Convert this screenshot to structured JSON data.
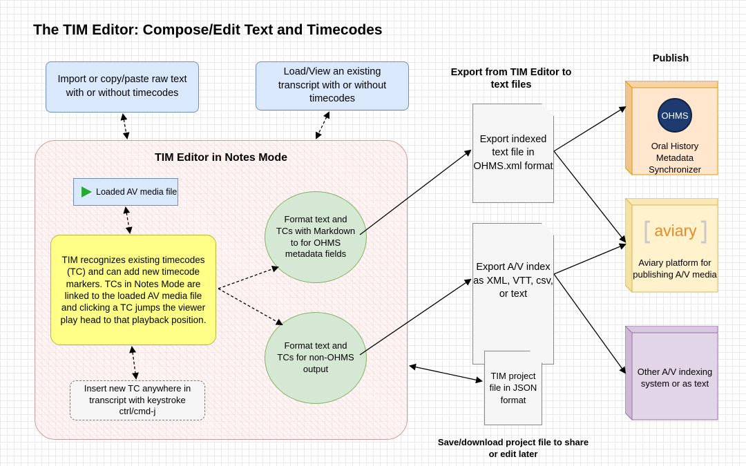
{
  "title": "The TIM Editor: Compose/Edit Text and Timecodes",
  "inputs": {
    "import": "Import or copy/paste raw text with or without timecodes",
    "load": "Load/View an existing transcript with or without timecodes"
  },
  "notes_mode": {
    "title": "TIM Editor in Notes Mode",
    "media_label": "Loaded AV media file",
    "recognize": "TIM recognizes existing timecodes (TC) and can add new timecode markers. TCs in Notes Mode are linked to the loaded AV media file and clicking a TC jumps the viewer play head to that playback position.",
    "insert": "Insert new TC anywhere in transcript with keystroke ctrl/cmd-j",
    "format_ohms": "Format text and TCs with Markdown to for OHMS metadata fields",
    "format_other": "Format text and TCs for non-OHMS output"
  },
  "export": {
    "header": "Export from TIM Editor to text files",
    "ohms": "Export indexed text file in OHMS.xml format",
    "av": "Export A/V index as XML, VTT, csv, or text",
    "project": "TIM project file in JSON format",
    "save_note": "Save/download project file to share or edit later"
  },
  "publish": {
    "header": "Publish",
    "ohms_logo": "OHMS",
    "ohms": "Oral History Metadata Synchronizer",
    "aviary_logo": "aviary",
    "aviary": "Aviary platform for publishing A/V media",
    "other": "Other A/V indexing system or as text"
  },
  "colors": {
    "input_fill": "#dae8fc",
    "notes_fill": "#ffecec",
    "yellow": "#ffff88",
    "green": "#d5e8d4",
    "orange": "#ffe6cc",
    "lightyellow": "#fff2cc",
    "purple": "#e1d5e7",
    "ohms_blue": "#1d3b6e",
    "aviary_orange": "#e8892b"
  }
}
